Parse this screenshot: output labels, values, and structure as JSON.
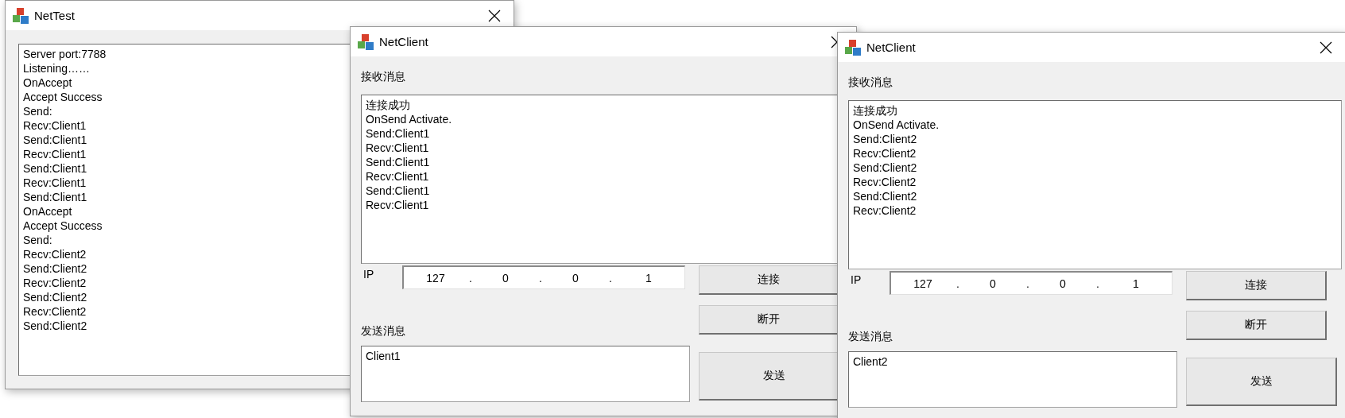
{
  "windows": [
    {
      "kind": "server",
      "title": "NetTest",
      "log": [
        "Server port:7788",
        "Listening……",
        "OnAccept",
        "Accept Success",
        "Send:",
        "Recv:Client1",
        "Send:Client1",
        "Recv:Client1",
        "Send:Client1",
        "Recv:Client1",
        "Send:Client1",
        "OnAccept",
        "Accept Success",
        "Send:",
        "Recv:Client2",
        "Send:Client2",
        "Recv:Client2",
        "Send:Client2",
        "Recv:Client2",
        "Send:Client2"
      ]
    },
    {
      "kind": "client",
      "title": "NetClient",
      "recv_label": "接收消息",
      "recv_log": [
        "连接成功",
        "OnSend Activate.",
        "Send:Client1",
        "Recv:Client1",
        "Send:Client1",
        "Recv:Client1",
        "Send:Client1",
        "Recv:Client1"
      ],
      "ip_label": "IP",
      "ip_octets": [
        "127",
        "0",
        "0",
        "1"
      ],
      "ip_separators": [
        ".",
        ".",
        "."
      ],
      "connect_button": "连接",
      "disconnect_button": "断开",
      "send_label": "发送消息",
      "send_text": "Client1",
      "send_button": "发送"
    },
    {
      "kind": "client",
      "title": "NetClient",
      "recv_label": "接收消息",
      "recv_log": [
        "连接成功",
        "OnSend Activate.",
        "Send:Client2",
        "Recv:Client2",
        "Send:Client2",
        "Recv:Client2",
        "Send:Client2",
        "Recv:Client2"
      ],
      "ip_label": "IP",
      "ip_octets": [
        "127",
        "0",
        "0",
        "1"
      ],
      "ip_separators": [
        ".",
        ".",
        "."
      ],
      "connect_button": "连接",
      "disconnect_button": "断开",
      "send_label": "发送消息",
      "send_text": "Client2",
      "send_button": "发送"
    }
  ]
}
